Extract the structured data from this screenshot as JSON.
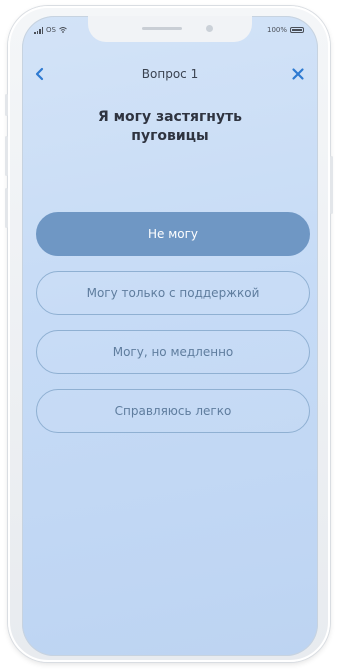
{
  "status_bar": {
    "carrier": "OS",
    "battery": "100%"
  },
  "header": {
    "title": "Вопрос 1"
  },
  "question": "Я могу застягнуть пуговицы",
  "options": [
    {
      "label": "Не могу",
      "selected": true
    },
    {
      "label": "Могу только с поддержкой",
      "selected": false
    },
    {
      "label": "Могу, но медленно",
      "selected": false
    },
    {
      "label": "Справляюсь легко",
      "selected": false
    }
  ],
  "colors": {
    "accent": "#6f97c4",
    "option_border": "#8fb0d2",
    "option_text": "#5f7d9e",
    "icon_blue": "#2e7ad1"
  },
  "icons": {
    "back": "chevron-left-icon",
    "close": "close-icon"
  }
}
